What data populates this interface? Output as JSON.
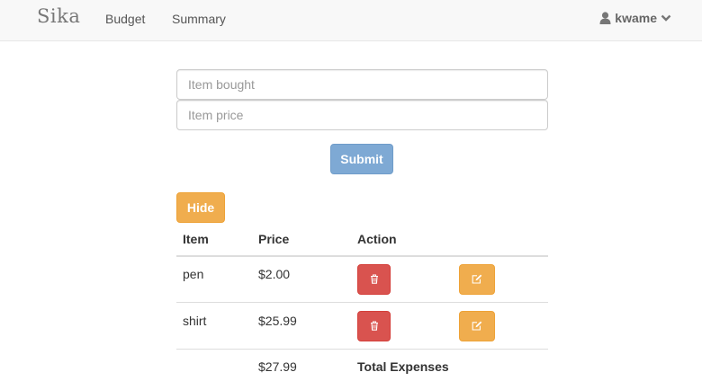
{
  "navbar": {
    "brand": "Sika",
    "links": [
      {
        "label": "Budget"
      },
      {
        "label": "Summary"
      }
    ],
    "user": {
      "name": "kwame",
      "icon": "user-icon",
      "caret": "chevron-down-icon"
    }
  },
  "form": {
    "item_placeholder": "Item bought",
    "price_placeholder": "Item price",
    "item_value": "",
    "price_value": "",
    "submit_label": "Submit"
  },
  "hide_button": {
    "label": "Hide"
  },
  "table": {
    "headers": [
      "Item",
      "Price",
      "Action"
    ],
    "rows": [
      {
        "item": "pen",
        "price": "$2.00",
        "delete_icon": "trash-icon",
        "edit_icon": "edit-icon"
      },
      {
        "item": "shirt",
        "price": "$25.99",
        "delete_icon": "trash-icon",
        "edit_icon": "edit-icon"
      }
    ],
    "total": {
      "price": "$27.99",
      "label": "Total Expenses"
    }
  },
  "colors": {
    "primary": "#7ea9d4",
    "warning": "#f0ad4e",
    "danger": "#d9534f",
    "navbar_bg": "#f8f8f8"
  }
}
